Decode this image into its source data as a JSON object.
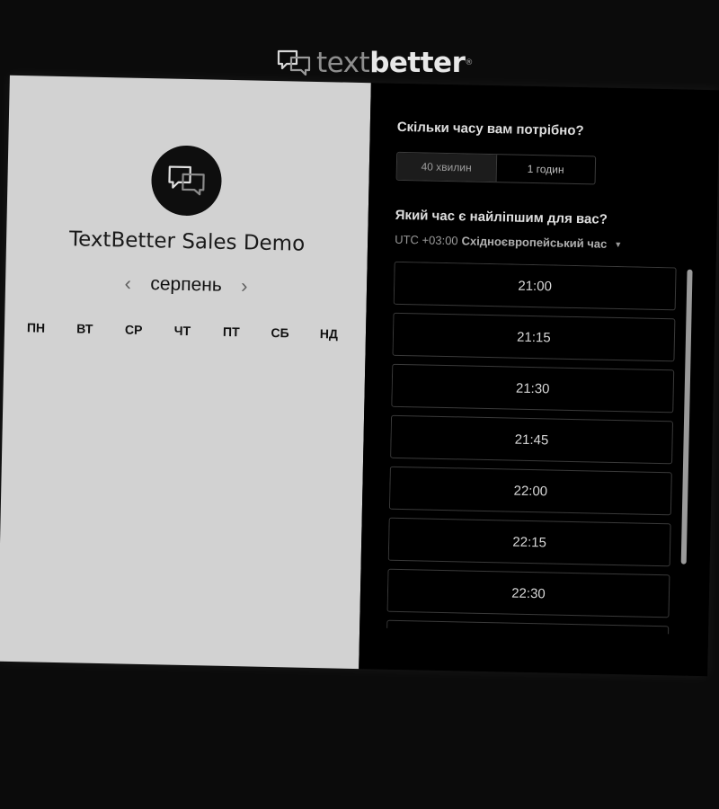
{
  "brand": {
    "logo_light": "text",
    "logo_bold": "better",
    "logo_reg": "®"
  },
  "event": {
    "title": "TextBetter Sales Demo"
  },
  "calendar": {
    "prev_icon": "‹",
    "next_icon": "›",
    "month": "серпень",
    "weekdays": [
      "ПН",
      "ВТ",
      "СР",
      "ЧТ",
      "ПТ",
      "СБ",
      "НД"
    ]
  },
  "duration": {
    "question": "Скільки часу вам потрібно?",
    "options": [
      "40 хвилин",
      "1 годин"
    ],
    "selected": "40 хвилин"
  },
  "time": {
    "question": "Який час є найліпшим для вас?",
    "timezone_offset": "UTC +03:00",
    "timezone_name": "Східноєвропейський час",
    "slots": [
      "21:00",
      "21:15",
      "21:30",
      "21:45",
      "22:00",
      "22:15",
      "22:30",
      ""
    ]
  },
  "icons": {
    "logo": "chat-bubbles-icon",
    "avatar": "chat-bubbles-icon",
    "prev": "chevron-left-icon",
    "next": "chevron-right-icon",
    "timezone": "caret-down-icon"
  },
  "colors": {
    "page_bg": "#0b0b0b",
    "left_panel": "#d2d2d2",
    "right_panel": "#000000"
  }
}
